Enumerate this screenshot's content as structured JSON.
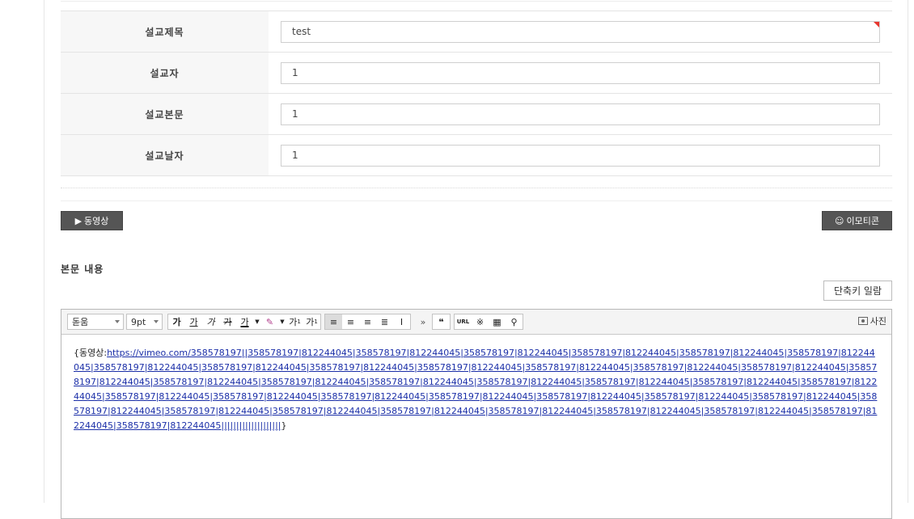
{
  "form": {
    "rows": [
      {
        "label": "설교제목",
        "value": "test"
      },
      {
        "label": "설교자",
        "value": "1"
      },
      {
        "label": "설교본문",
        "value": "1"
      },
      {
        "label": "설교날자",
        "value": "1"
      }
    ]
  },
  "buttons": {
    "video": "동영상",
    "emoticon": "이모티콘",
    "shortcut": "단축키 일람",
    "photo": "사진"
  },
  "section_title": "본문 내용",
  "editor": {
    "font_select": "돋움",
    "size_select": "9pt",
    "tools_text": [
      "가",
      "가",
      "가",
      "가",
      "가"
    ],
    "tools_sup": [
      "가",
      "가"
    ],
    "content_prefix": "{동영상:",
    "content_link": "https://vimeo.com/358578197||358578197|812244045|358578197|812244045|358578197|812244045|358578197|812244045|358578197|812244045|358578197|812244045|358578197|812244045|358578197|812244045|358578197|812244045|358578197|812244045|358578197|812244045|358578197|812244045|358578197|812244045|358578197|812244045|358578197|812244045|358578197|812244045|358578197|812244045|358578197|812244045|358578197|812244045|358578197|812244045|358578197|812244045|358578197|812244045|358578197|812244045|358578197|812244045|358578197|812244045|358578197|812244045|358578197|812244045|358578197|812244045|358578197|812244045|358578197|812244045|358578197|812244045|358578197|812244045|358578197|812244045|358578197|812244045|358578197|812244045|358578197|812244045|358578197|812244045||||||||||||||||||||",
    "content_suffix": "}"
  }
}
